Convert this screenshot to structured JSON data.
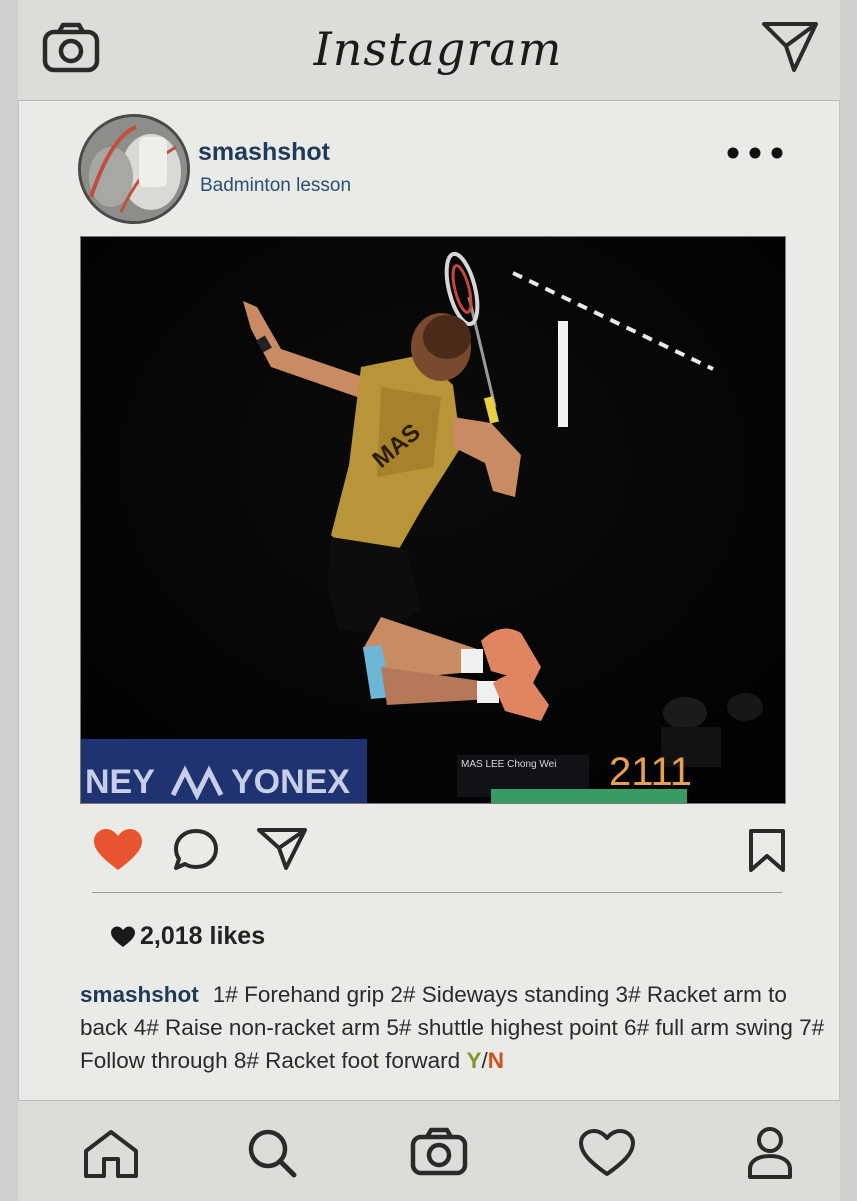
{
  "header": {
    "title": "Instagram",
    "icons": [
      "camera-icon",
      "send-icon"
    ]
  },
  "post": {
    "username": "smashshot",
    "location": "Badminton lesson",
    "menu_icon": "more-dots-icon",
    "photo": {
      "banner_text": "YONEX",
      "banner_text_left": "NEY",
      "scoreboard_score": "2111",
      "scoreboard_name": "MAS LEE Chong Wei",
      "jersey_text": "MAS"
    },
    "actions": [
      "heart-icon",
      "comment-icon",
      "send-icon",
      "bookmark-icon"
    ],
    "likes": "2,018 likes",
    "caption": {
      "user": "smashshot",
      "text": "1# Forehand grip 2# Sideways standing 3# Racket arm to back 4# Raise non-racket arm 5# shuttle highest point 6# full arm swing 7# Follow through 8# Racket foot forward ",
      "yes": "Y",
      "slash": "/",
      "no": "N"
    }
  },
  "colors": {
    "heart_filled": "#e8542f",
    "username": "#1d3a5a",
    "yes": "#7c9a2a",
    "no": "#d25020"
  },
  "bottom_nav": [
    "home-icon",
    "search-icon",
    "camera-icon",
    "heart-icon",
    "profile-icon"
  ]
}
